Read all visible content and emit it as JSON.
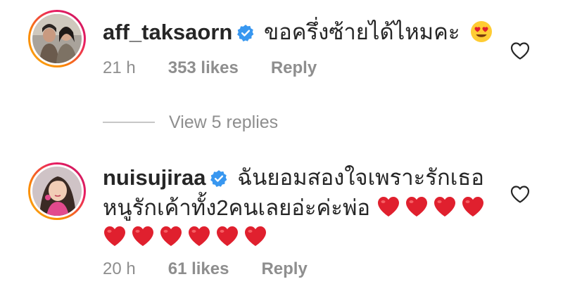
{
  "comments": [
    {
      "username": "aff_taksaorn",
      "verified": true,
      "text_lines": [
        "ขอครึ่งซ้ายได้ไหมคะ"
      ],
      "trailing_emoji": "heart-eyes-emoji",
      "time": "21 h",
      "likes": "353 likes",
      "reply_label": "Reply",
      "view_replies": "View 5 replies"
    },
    {
      "username": "nuisujiraa",
      "verified": true,
      "text_lines": [
        "ฉันยอมสองใจเพราะรักเธอ",
        "หนูรักเค้าทั้ง2คนเลยอ่ะค่ะพ่อ"
      ],
      "hearts_line2": 4,
      "hearts_line3": 6,
      "time": "20 h",
      "likes": "61 likes",
      "reply_label": "Reply"
    }
  ],
  "colors": {
    "text": "#262626",
    "meta": "#8e8e8e",
    "verified": "#3897f0",
    "heart": "#e0202e"
  },
  "icons": {
    "like": "heart-outline-icon",
    "verified": "verified-badge-icon"
  }
}
